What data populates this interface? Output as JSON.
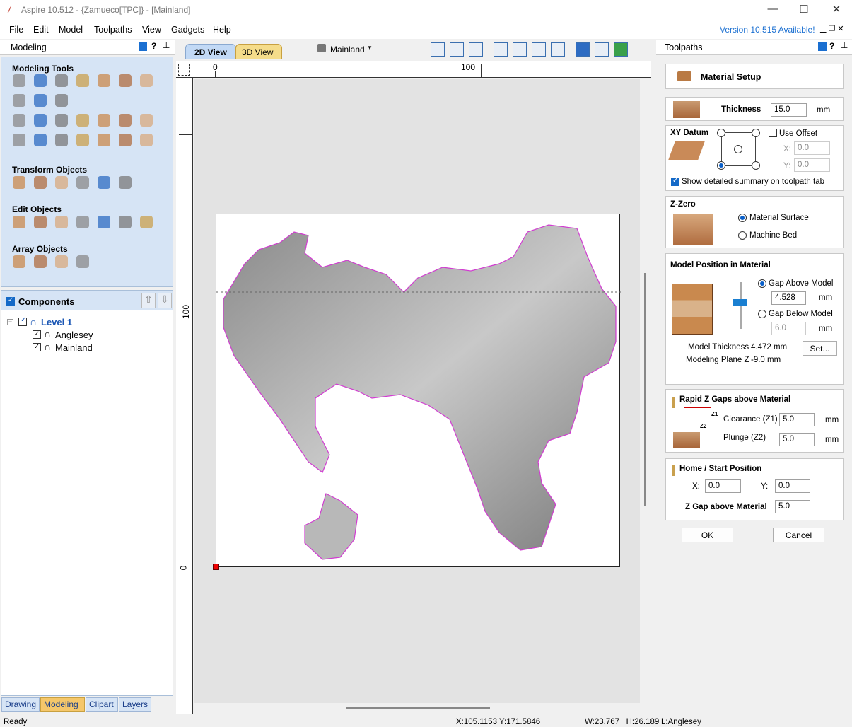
{
  "window": {
    "title": "Aspire 10.512 - {Zamueco[TPC]} - [Mainland]"
  },
  "menu": [
    "File",
    "Edit",
    "Model",
    "Toolpaths",
    "View",
    "Gadgets",
    "Help"
  ],
  "version_notice": "Version 10.515 Available!",
  "left_panel": {
    "title": "Modeling",
    "sections": {
      "modeling_tools": "Modeling Tools",
      "transform_objects": "Transform Objects",
      "edit_objects": "Edit Objects",
      "array_objects": "Array Objects"
    },
    "components": {
      "title": "Components",
      "level": "Level 1",
      "items": [
        "Anglesey",
        "Mainland"
      ]
    },
    "bottom_tabs": [
      "Drawing",
      "Modeling",
      "Clipart",
      "Layers"
    ]
  },
  "view": {
    "tabs": [
      "2D View",
      "3D View"
    ],
    "component_select": "Mainland",
    "ruler_h": [
      "0",
      "100"
    ],
    "ruler_v": [
      "100",
      "0"
    ]
  },
  "right_panel": {
    "title": "Toolpaths",
    "material_setup": "Material Setup",
    "thickness": {
      "label": "Thickness",
      "value": "15.0",
      "unit": "mm"
    },
    "xy_datum": {
      "label": "XY Datum",
      "use_offset": "Use Offset",
      "x_label": "X:",
      "x_value": "0.0",
      "y_label": "Y:",
      "y_value": "0.0",
      "show_summary": "Show detailed summary on toolpath tab"
    },
    "z_zero": {
      "label": "Z-Zero",
      "opt1": "Material Surface",
      "opt2": "Machine Bed"
    },
    "model_position": {
      "title": "Model Position in Material",
      "gap_above": "Gap Above Model",
      "gap_above_value": "4.528",
      "gap_below": "Gap Below Model",
      "gap_below_value": "6.0",
      "unit": "mm",
      "model_thickness_label": "Model Thickness",
      "model_thickness_value": "4.472 mm",
      "modeling_plane_label": "Modeling Plane Z",
      "modeling_plane_value": "-9.0 mm",
      "set_button": "Set..."
    },
    "rapid_z": {
      "title": "Rapid Z Gaps above Material",
      "clearance_label": "Clearance (Z1)",
      "clearance_value": "5.0",
      "plunge_label": "Plunge (Z2)",
      "plunge_value": "5.0",
      "unit": "mm",
      "z1": "Z1",
      "z2": "Z2"
    },
    "home": {
      "title": "Home / Start Position",
      "x_label": "X:",
      "x_value": "0.0",
      "y_label": "Y:",
      "y_value": "0.0",
      "zgap_label": "Z Gap above Material",
      "zgap_value": "5.0"
    },
    "ok": "OK",
    "cancel": "Cancel"
  },
  "status": {
    "ready": "Ready",
    "coords": "X:105.1153 Y:171.5846",
    "size": "W:23.767   H:26.189",
    "layer": "L:Anglesey"
  }
}
